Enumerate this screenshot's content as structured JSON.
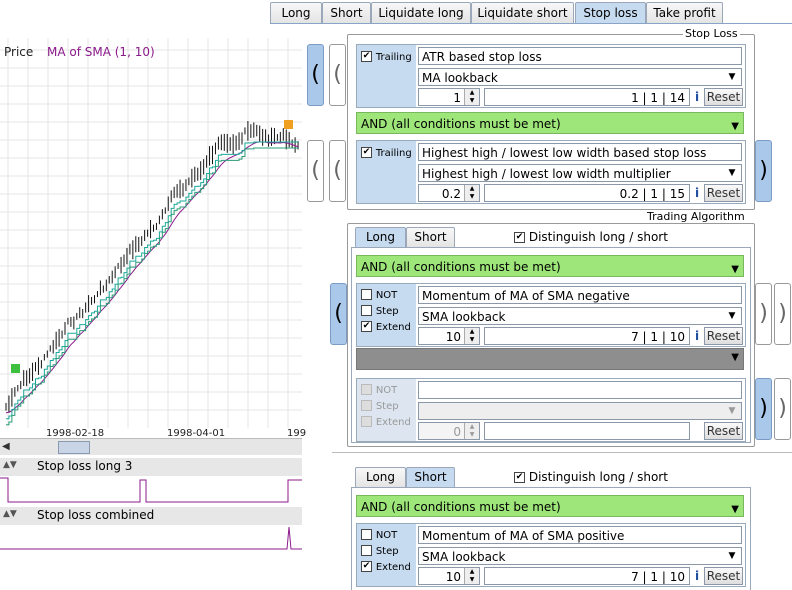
{
  "tabs": [
    "Long",
    "Short",
    "Liquidate long",
    "Liquidate short",
    "Stop loss",
    "Take profit"
  ],
  "selected_tab": "Stop loss",
  "chart": {
    "price_label": "Price",
    "ma_label": "MA of SMA (1, 10)",
    "x_ticks": [
      "1998-02-18",
      "1998-04-01",
      "199"
    ]
  },
  "indicators": [
    {
      "name": "Stop loss long 3"
    },
    {
      "name": "Stop loss combined"
    }
  ],
  "stop_loss": {
    "title": "Stop Loss",
    "rule1": {
      "trailing_label": "Trailing",
      "trailing_checked": "✔",
      "name": "ATR based stop loss",
      "param": "MA lookback",
      "value": "1",
      "range": "1  |  1  |  14",
      "info": "i",
      "reset": "Reset"
    },
    "operator": "AND    (all conditions must be met)",
    "rule2": {
      "trailing_label": "Trailing",
      "trailing_checked": "✔",
      "name": "Highest high / lowest low width based stop loss",
      "param": "Highest high / lowest low width multiplier",
      "value": "0.2",
      "range": "0.2  |  1  |  15",
      "info": "i",
      "reset": "Reset"
    }
  },
  "trading_algorithm": {
    "title": "Trading Algorithm",
    "tabs": [
      "Long",
      "Short"
    ],
    "selected": "Long",
    "distinguish_label": "Distinguish long / short",
    "distinguish_checked": "✔",
    "operator": "AND    (all conditions must be met)",
    "cond1": {
      "not_label": "NOT",
      "step_label": "Step",
      "extend_label": "Extend",
      "extend_checked": "✔",
      "name": "Momentum of MA of SMA negative",
      "param": "SMA lookback",
      "value": "10",
      "range": "7  |  1  |  10",
      "info": "i",
      "reset": "Reset"
    },
    "cond2": {
      "not_label": "NOT",
      "step_label": "Step",
      "extend_label": "Extend",
      "value": "0",
      "reset": "Reset"
    }
  },
  "short_panel": {
    "tabs": [
      "Long",
      "Short"
    ],
    "selected": "Short",
    "distinguish_label": "Distinguish long / short",
    "distinguish_checked": "✔",
    "operator": "AND    (all conditions must be met)",
    "cond1": {
      "not_label": "NOT",
      "step_label": "Step",
      "extend_label": "Extend",
      "extend_checked": "✔",
      "name": "Momentum of MA of SMA positive",
      "param": "SMA lookback",
      "value": "10",
      "range": "7  |  1  |  10",
      "info": "i",
      "reset": "Reset"
    }
  },
  "colors": {
    "accent": "#c6daf0",
    "green": "#9ee67a",
    "ma": "#8b1a8b",
    "trail": "#1aa89a"
  }
}
